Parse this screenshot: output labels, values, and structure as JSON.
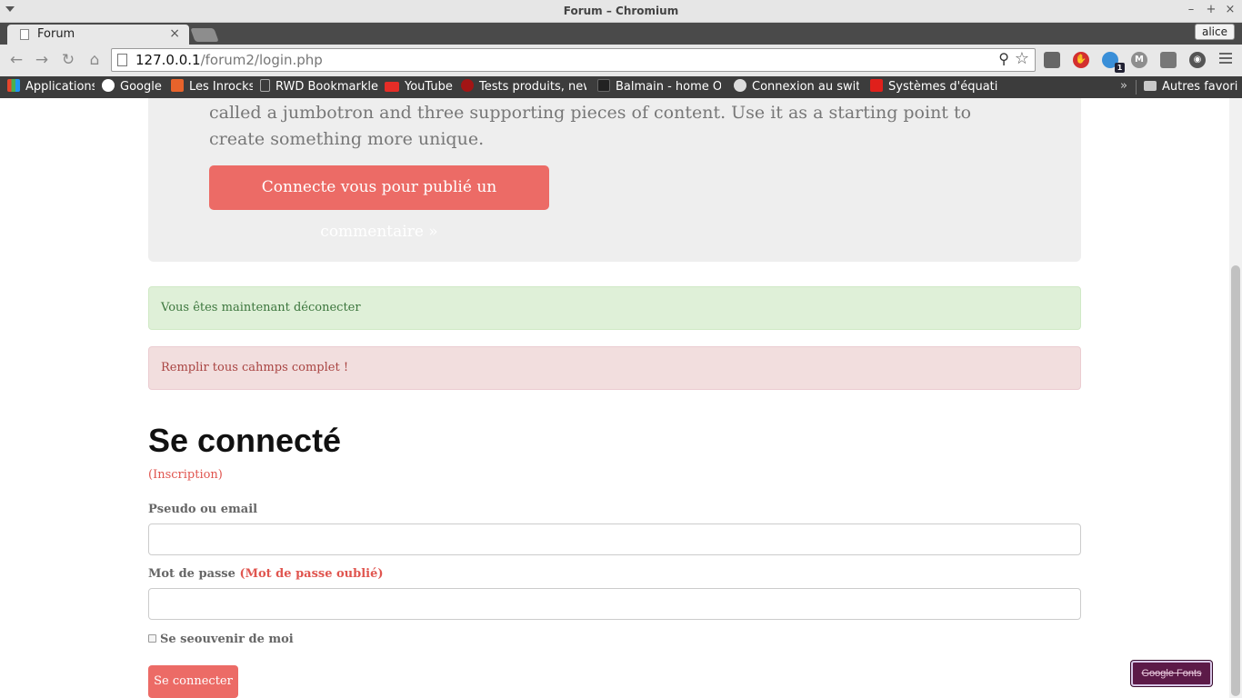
{
  "window": {
    "title": "Forum – Chromium",
    "controls": [
      "–",
      "+",
      "×"
    ]
  },
  "tab": {
    "title": "Forum",
    "close": "×"
  },
  "profile": {
    "name": "alice"
  },
  "omnibox": {
    "host": "127.0.0.1",
    "path": "/forum2/login.php"
  },
  "icons": {
    "back": "back-arrow-icon",
    "forward": "forward-arrow-icon",
    "reload": "reload-icon",
    "home": "home-icon",
    "zoom": "zoom-icon",
    "star": "bookmark-star-icon"
  },
  "extensions": [
    {
      "name": "extension-icon-1",
      "color": "#666666"
    },
    {
      "name": "adblock-icon",
      "color": "#d32f2f"
    },
    {
      "name": "ghostery-icon",
      "color": "#3a8fd8",
      "badge": "1"
    },
    {
      "name": "gmail-icon",
      "color": "#8e8e8e"
    },
    {
      "name": "extension-icon-5",
      "color": "#777777"
    },
    {
      "name": "extension-icon-6",
      "color": "#555555"
    }
  ],
  "bookmarks": [
    {
      "label": "Applications",
      "color": "#e6452c"
    },
    {
      "label": "Google",
      "color": "#ffffff"
    },
    {
      "label": "Les Inrocks",
      "color": "#e8632b"
    },
    {
      "label": "RWD Bookmarklet",
      "color": "#aaaaaa"
    },
    {
      "label": "YouTube",
      "color": "#e52d27"
    },
    {
      "label": "Tests produits, new",
      "color": "#a31515"
    },
    {
      "label": "Balmain - home On",
      "color": "#222222"
    },
    {
      "label": "Connexion au switc",
      "color": "#dddddd"
    },
    {
      "label": "Systèmes d'équatio",
      "color": "#e0201b"
    }
  ],
  "bookmarks_more": "»",
  "other_bookmarks": "Autres favoris",
  "page": {
    "jumbotron_text": "called a jumbotron and three supporting pieces of content. Use it as a starting point to create something more unique.",
    "jumbotron_button": "Connecte vous pour publié un commentaire »",
    "alert_success": "Vous êtes maintenant déconecter",
    "alert_danger": "Remplir tous cahmps complet !",
    "form_title": "Se connecté",
    "register_link": "(Inscription)",
    "login_label": "Pseudo ou email",
    "login_value": "",
    "password_label": "Mot de passe",
    "forgot_link": "(Mot de passe oublié)",
    "password_value": "",
    "remember_label": "Se seouvenir de moi",
    "remember_checked": false,
    "submit_label": "Se connecter"
  },
  "google_fonts_badge": "Google Fonts",
  "colors": {
    "primary_button": "#ec6b66",
    "success_bg": "#dff0d8",
    "danger_bg": "#f2dede"
  }
}
